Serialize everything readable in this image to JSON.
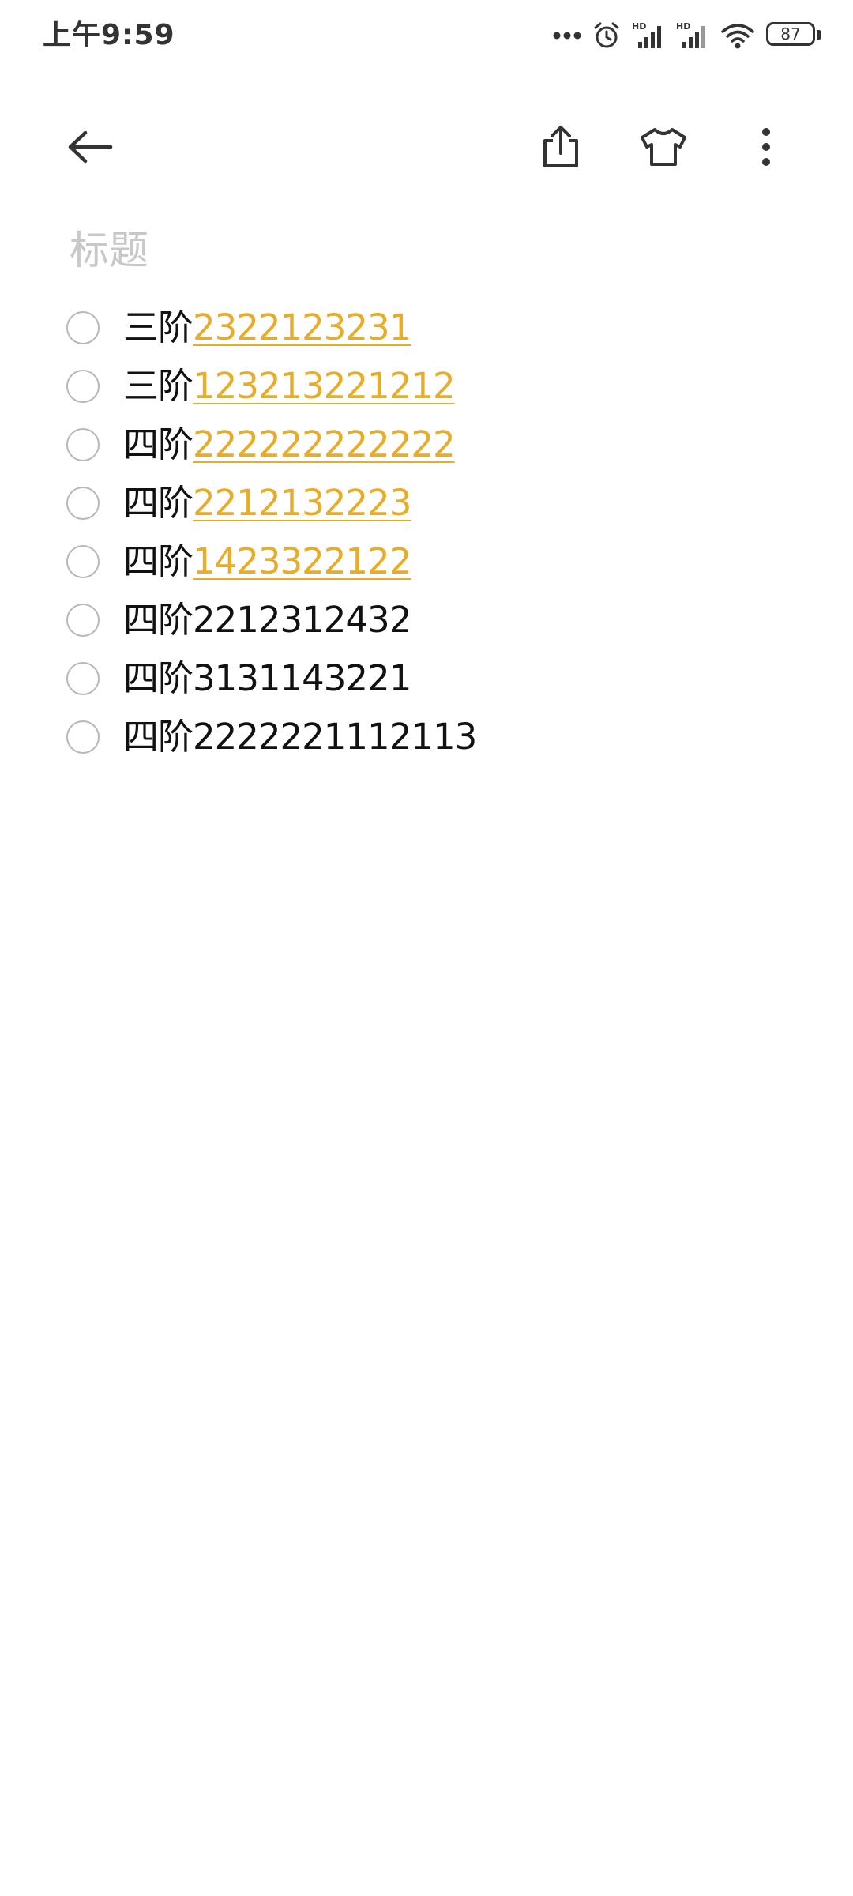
{
  "status_bar": {
    "time": "上午9:59",
    "battery_level": "87",
    "icons": [
      "more-dots-icon",
      "alarm-icon",
      "hd-signal-icon",
      "hd-signal-icon",
      "wifi-icon",
      "battery-icon"
    ]
  },
  "toolbar": {
    "back_icon": "back-arrow-icon",
    "share_icon": "share-icon",
    "theme_icon": "tshirt-icon",
    "more_icon": "more-vertical-icon"
  },
  "note": {
    "title_placeholder": "标题",
    "items": [
      {
        "prefix": "三阶",
        "link": "2322123231",
        "text": "",
        "checked": false
      },
      {
        "prefix": "三阶",
        "link": "123213221212",
        "text": "",
        "checked": false
      },
      {
        "prefix": "四阶",
        "link": "222222222222",
        "text": "",
        "checked": false
      },
      {
        "prefix": "四阶",
        "link": "2212132223",
        "text": "",
        "checked": false
      },
      {
        "prefix": "四阶",
        "link": "1423322122",
        "text": "",
        "checked": false
      },
      {
        "prefix": "四阶",
        "link": "",
        "text": "2212312432",
        "checked": false
      },
      {
        "prefix": "四阶",
        "link": "",
        "text": "3131143221",
        "checked": false
      },
      {
        "prefix": "四阶",
        "link": "",
        "text": "2222221112113",
        "checked": false
      }
    ]
  },
  "colors": {
    "link": "#e8ad28",
    "placeholder": "#c8c8c8",
    "icon": "#333333",
    "checkbox_border": "#b8b8b8"
  }
}
